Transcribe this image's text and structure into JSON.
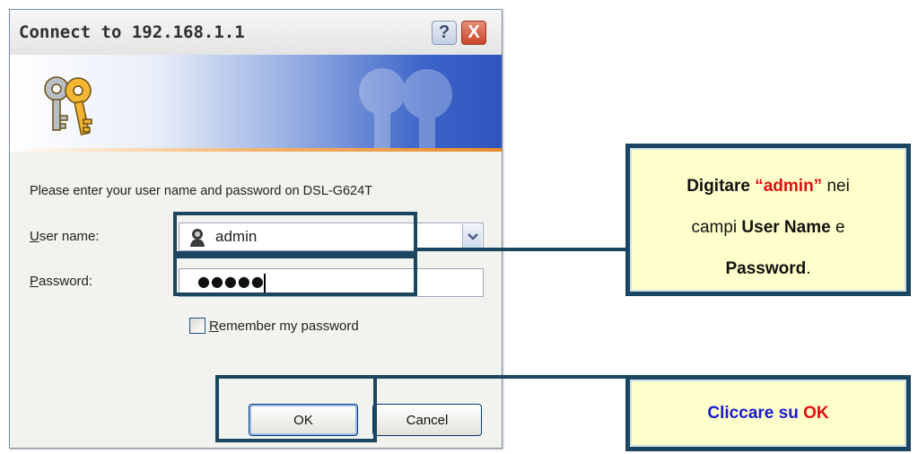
{
  "dialog": {
    "title": "Connect to 192.168.1.1",
    "help_label": "?",
    "close_label": "X",
    "prompt": "Please enter your user name and password on DSL-G624T",
    "username_label_first": "U",
    "username_label_rest": "ser name:",
    "username_value": "admin",
    "password_label_first": "P",
    "password_label_rest": "assword:",
    "password_value": "●●●●●",
    "remember_first": "R",
    "remember_rest": "emember my password",
    "remember_checked": false,
    "ok_label": "OK",
    "cancel_label": "Cancel"
  },
  "callouts": {
    "first": {
      "part1": "Digitare",
      "part2": "“admin”",
      "part3": "nei",
      "part4": "campi",
      "part5": "User Name",
      "part6": "e",
      "part7": "Password",
      "part8": "."
    },
    "second": {
      "part1": "Cliccare su",
      "part2": "OK"
    }
  },
  "colors": {
    "frame": "#1a4661",
    "callout_bg": "#ffffcc",
    "highlight_red": "#e01010",
    "highlight_blue": "#1a1ad0"
  }
}
